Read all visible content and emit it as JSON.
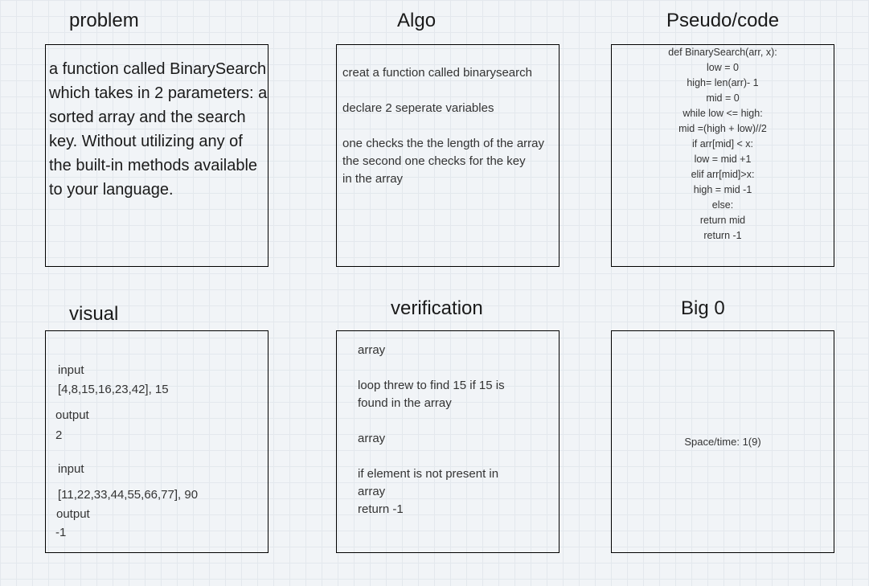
{
  "titles": {
    "problem": "problem",
    "algo": "Algo",
    "pseudo": "Pseudo/code",
    "visual": "visual",
    "verification": "verification",
    "big_o": "Big 0"
  },
  "problem": {
    "text": "a function called BinarySearch which takes in 2 parameters: a sorted array and the search key. Without utilizing any of the built-in methods available to your language."
  },
  "algo": {
    "line1": "creat a function called binarysearch",
    "line2": "declare 2 seperate variables",
    "line3": "one checks the the length of the array",
    "line4": "the second one checks for the key",
    "line5": "in the array"
  },
  "pseudo": {
    "lines": [
      "def BinarySearch(arr, x):",
      "low = 0",
      "high= len(arr)- 1",
      "mid = 0",
      "while low <= high:",
      "mid =(high + low)//2",
      "if arr[mid] < x:",
      "low = mid +1",
      "elif arr[mid]>x:",
      "high = mid -1",
      "else:",
      "return mid",
      "return -1"
    ]
  },
  "visual": {
    "input1_label": "input",
    "input1_value": "[4,8,15,16,23,42], 15",
    "output1_label": "output",
    "output1_value": "2",
    "input2_label": "input",
    "input2_value": "[11,22,33,44,55,66,77], 90",
    "output2_label": "output",
    "output2_value": "-1"
  },
  "verification": {
    "line1": "array",
    "line2": "loop threw to find 15 if 15 is",
    "line3": "found in the array",
    "line4": "array",
    "line5": "if element is not present in",
    "line6": "array",
    "line7": "return -1"
  },
  "big_o": {
    "text": "Space/time: 1(9)"
  }
}
